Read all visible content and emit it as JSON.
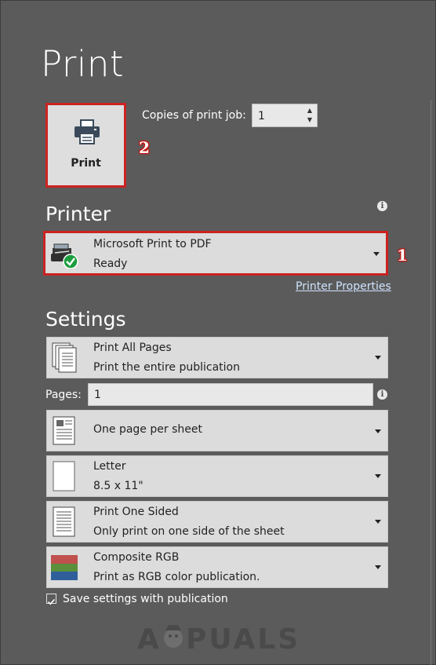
{
  "title": "Print",
  "print_button": {
    "label": "Print"
  },
  "copies": {
    "label": "Copies of print job:",
    "value": "1"
  },
  "printer": {
    "heading": "Printer",
    "name": "Microsoft Print to PDF",
    "status": "Ready",
    "properties_link": "Printer Properties"
  },
  "settings": {
    "heading": "Settings",
    "pages_range": {
      "main": "Print All Pages",
      "sub": "Print the entire publication"
    },
    "pages_label": "Pages:",
    "pages_value": "1",
    "layout": {
      "main": "One page per sheet"
    },
    "paper": {
      "main": "Letter",
      "sub": "8.5 x 11\""
    },
    "sides": {
      "main": "Print One Sided",
      "sub": "Only print on one side of the sheet"
    },
    "color": {
      "main": "Composite RGB",
      "sub": "Print as RGB color publication."
    },
    "save_checkbox": {
      "label": "Save settings with publication",
      "checked": true
    }
  },
  "annotations": {
    "badge_1": "1",
    "badge_2": "2"
  },
  "watermark": {
    "text": "APPUALS"
  },
  "colors": {
    "background": "#5b5b5b",
    "highlight": "#cc2222",
    "link": "#cfe3ff"
  },
  "icons": {
    "printer": "printer-icon",
    "info": "info-icon",
    "check": "checkmark-icon"
  }
}
